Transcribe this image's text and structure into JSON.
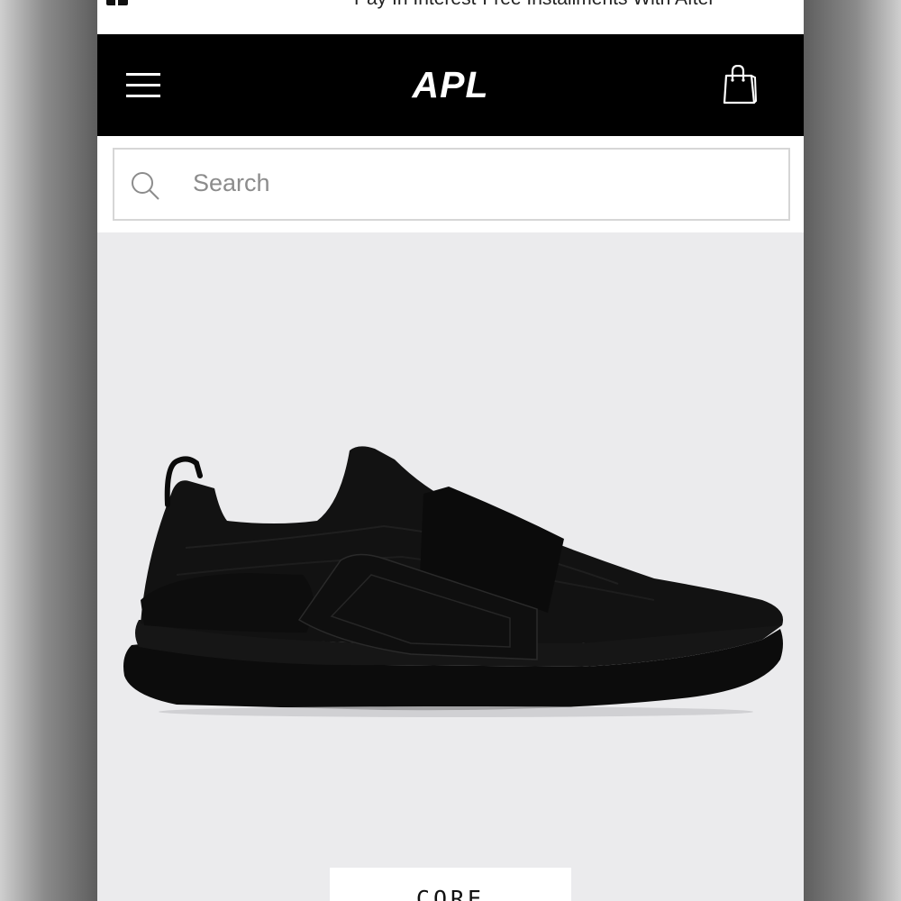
{
  "promo": {
    "text": "Pay In Interest-Free Installments With After"
  },
  "header": {
    "logo": "APL"
  },
  "search": {
    "placeholder": "Search"
  },
  "product": {
    "collection_label": "CORE COLLECTION"
  },
  "icons": {
    "menu": "hamburger-menu-icon",
    "cart": "shopping-bag-icon",
    "search": "search-icon"
  },
  "colors": {
    "header_bg": "#000000",
    "product_bg": "#ebebed",
    "shoe": "#121212"
  }
}
